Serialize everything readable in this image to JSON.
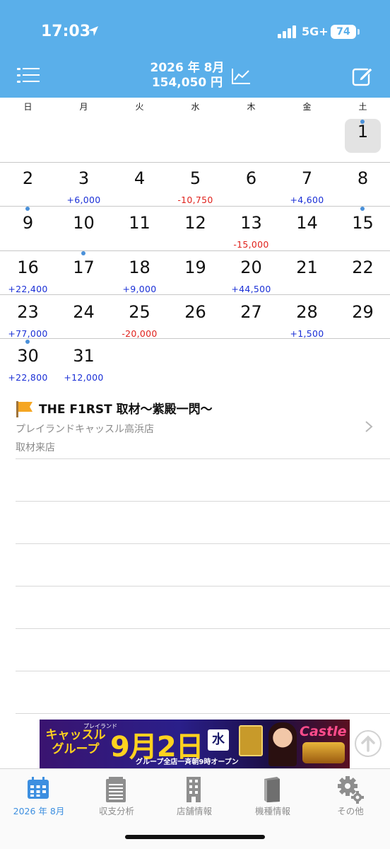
{
  "status_bar": {
    "time": "17:03",
    "network": "5G+",
    "battery": "74"
  },
  "header": {
    "month": "2026 年 8月",
    "total": "154,050 円"
  },
  "weekdays": [
    "日",
    "月",
    "火",
    "水",
    "木",
    "金",
    "土"
  ],
  "calendar_days": [
    {
      "day": "1",
      "amount": ""
    },
    {
      "day": "2",
      "amount": ""
    },
    {
      "day": "3",
      "amount": "+6,000"
    },
    {
      "day": "4",
      "amount": ""
    },
    {
      "day": "5",
      "amount": "-10,750"
    },
    {
      "day": "6",
      "amount": ""
    },
    {
      "day": "7",
      "amount": "+4,600"
    },
    {
      "day": "8",
      "amount": ""
    },
    {
      "day": "9",
      "amount": ""
    },
    {
      "day": "10",
      "amount": ""
    },
    {
      "day": "11",
      "amount": ""
    },
    {
      "day": "12",
      "amount": ""
    },
    {
      "day": "13",
      "amount": "-15,000"
    },
    {
      "day": "14",
      "amount": ""
    },
    {
      "day": "15",
      "amount": ""
    },
    {
      "day": "16",
      "amount": "+22,400"
    },
    {
      "day": "17",
      "amount": ""
    },
    {
      "day": "18",
      "amount": "+9,000"
    },
    {
      "day": "19",
      "amount": ""
    },
    {
      "day": "20",
      "amount": "+44,500"
    },
    {
      "day": "21",
      "amount": ""
    },
    {
      "day": "22",
      "amount": ""
    },
    {
      "day": "23",
      "amount": "+77,000"
    },
    {
      "day": "24",
      "amount": ""
    },
    {
      "day": "25",
      "amount": "-20,000"
    },
    {
      "day": "26",
      "amount": ""
    },
    {
      "day": "27",
      "amount": ""
    },
    {
      "day": "28",
      "amount": "+1,500"
    },
    {
      "day": "29",
      "amount": ""
    },
    {
      "day": "30",
      "amount": "+22,800"
    },
    {
      "day": "31",
      "amount": "+12,000"
    }
  ],
  "event_marked_days": [
    "1",
    "9",
    "15",
    "17",
    "30"
  ],
  "selected_day": "1",
  "event": {
    "title": "THE F1RST 取材〜紫殿一閃〜",
    "store": "プレイランドキャッスル高浜店",
    "type": "取材来店"
  },
  "banner": {
    "brand_small": "プレイランド",
    "brand": "キャッスル グループ",
    "date": "9月2日",
    "weekday": "水",
    "subtitle": "グループ全店一斉朝9時オープン",
    "logo": "Castle"
  },
  "tabs": [
    {
      "label": "2026 年 8月",
      "icon": "calendar-icon",
      "active": true
    },
    {
      "label": "収支分析",
      "icon": "notepad-icon",
      "active": false
    },
    {
      "label": "店舗情報",
      "icon": "building-icon",
      "active": false
    },
    {
      "label": "機種情報",
      "icon": "book-icon",
      "active": false
    },
    {
      "label": "その他",
      "icon": "gear-icon",
      "active": false
    }
  ],
  "colors": {
    "header": "#5aafea",
    "positive": "#1a2fd6",
    "negative": "#e0221c",
    "accent": "#3d8fe0",
    "dot": "#4a90d9"
  }
}
